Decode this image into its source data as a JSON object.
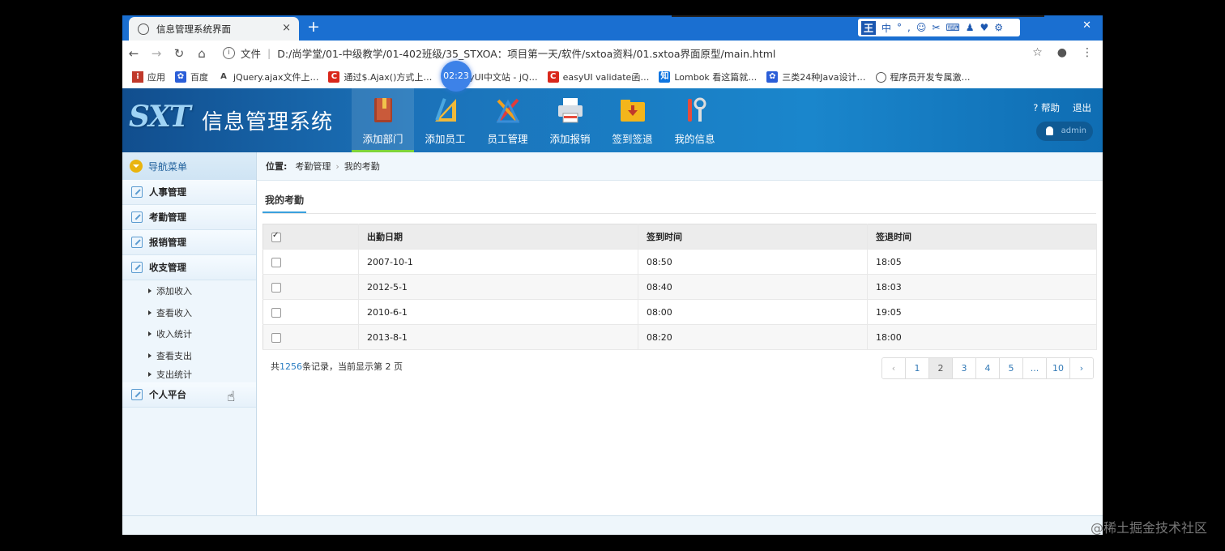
{
  "browser": {
    "tab_title": "信息管理系统界面",
    "tab_close": "×",
    "new_tab": "+",
    "address_prefix": "文件",
    "address": "D:/尚学堂/01-中级教学/01-402班级/35_STXOA：项目第一天/软件/sxtoa资料/01.sxtoa界面原型/main.html",
    "ime": [
      "王",
      "中",
      "°",
      ",",
      "☺",
      "✂",
      "⌨",
      "♟",
      "♥",
      "⚙"
    ],
    "timer": "02:23",
    "bookmarks": [
      "应用",
      "百度",
      "jQuery.ajax文件上…",
      "通过$.Ajax()方式上…",
      "syUI中文站 - jQ…",
      "easyUI validate函…",
      "Lombok 看这篇就…",
      "三类24种Java设计…",
      "程序员开发专属激…"
    ],
    "bookmark_icons": [
      "apps-icon",
      "baidu-icon",
      "jquery-icon",
      "csdn-icon",
      "site-icon",
      "csdn-icon",
      "zhihu-icon",
      "baidu-icon",
      "globe-icon"
    ]
  },
  "header": {
    "logo": "SXT",
    "title": "信息管理系统",
    "nav": [
      {
        "label": "添加部门",
        "icon": "book-icon",
        "active": true
      },
      {
        "label": "添加员工",
        "icon": "ruler-icon",
        "active": false
      },
      {
        "label": "员工管理",
        "icon": "tools-icon",
        "active": false
      },
      {
        "label": "添加报销",
        "icon": "printer-icon",
        "active": false
      },
      {
        "label": "签到签退",
        "icon": "folder-icon",
        "active": false
      },
      {
        "label": "我的信息",
        "icon": "wrench-icon",
        "active": false
      }
    ],
    "help": "帮助",
    "logout": "退出",
    "user": "admin"
  },
  "sidebar": {
    "title": "导航菜单",
    "groups": [
      {
        "label": "人事管理"
      },
      {
        "label": "考勤管理"
      },
      {
        "label": "报销管理"
      },
      {
        "label": "收支管理",
        "children": [
          "添加收入",
          "查看收入",
          "收入统计",
          "查看支出",
          "支出统计"
        ]
      },
      {
        "label": "个人平台"
      }
    ]
  },
  "content": {
    "breadcrumb_label": "位置:",
    "breadcrumb": [
      "考勤管理",
      "我的考勤"
    ],
    "tab": "我的考勤",
    "table": {
      "columns": [
        "出勤日期",
        "签到时间",
        "签退时间"
      ],
      "rows": [
        [
          "2007-10-1",
          "08:50",
          "18:05"
        ],
        [
          "2012-5-1",
          "08:40",
          "18:03"
        ],
        [
          "2010-6-1",
          "08:00",
          "19:05"
        ],
        [
          "2013-8-1",
          "08:20",
          "18:00"
        ]
      ]
    },
    "summary_pre": "共",
    "summary_count": "1256",
    "summary_post": "条记录，当前显示第 2 页",
    "pager": [
      "‹",
      "1",
      "2",
      "3",
      "4",
      "5",
      "...",
      "10",
      "›"
    ],
    "pager_current": "2"
  },
  "watermark": "@稀土掘金技术社区"
}
